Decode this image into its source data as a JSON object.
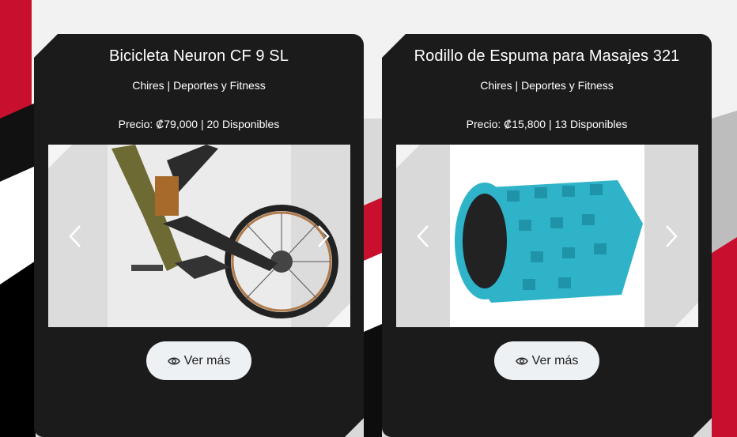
{
  "products": [
    {
      "title": "Bicicleta Neuron CF 9 SL",
      "location": "Chires | Deportes y Fitness",
      "price_label": "Precio: ₡79,000 | 20 Disponibles",
      "image_icon": "bicycle-photo",
      "button_label": "Ver más"
    },
    {
      "title": "Rodillo de Espuma para Masajes 321",
      "location": "Chires | Deportes y Fitness",
      "price_label": "Precio: ₡15,800 | 13 Disponibles",
      "image_icon": "foam-roller-photo",
      "button_label": "Ver más"
    }
  ],
  "icons": {
    "prev": "chevron-left-icon",
    "next": "chevron-right-icon",
    "view": "eye-icon"
  },
  "colors": {
    "card_bg": "#1b1b1c",
    "button_bg": "#eef1f4",
    "accent_red": "#c8102e"
  }
}
